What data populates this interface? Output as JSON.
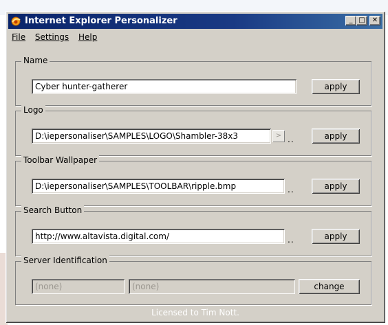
{
  "window": {
    "title": "Internet Explorer Personalizer",
    "accent": "#0a246a",
    "controls": {
      "minimize": "_",
      "maximize": "□",
      "close": "✕"
    }
  },
  "menu": [
    "File",
    "Settings",
    "Help"
  ],
  "name_group": {
    "label": "Name",
    "value": "Cyber hunter-gatherer",
    "apply_label": "apply"
  },
  "logo_group": {
    "label": "Logo",
    "value": "D:\\iepersonaliser\\SAMPLES\\LOGO\\Shambler-38x3",
    "browse_icon": "right-arrow-icon",
    "dots": "..",
    "apply_label": "apply"
  },
  "toolbar_group": {
    "label": "Toolbar Wallpaper",
    "value": "D:\\iepersonaliser\\SAMPLES\\TOOLBAR\\ripple.bmp",
    "dots": "..",
    "apply_label": "apply"
  },
  "search_group": {
    "label": "Search Button",
    "value": "http://www.altavista.digital.com/",
    "dots": "..",
    "apply_label": "apply"
  },
  "server_group": {
    "label": "Server Identification",
    "field1": "(none)",
    "field2": "(none)",
    "change_label": "change"
  },
  "status_text": "Licensed to Tim Nott."
}
